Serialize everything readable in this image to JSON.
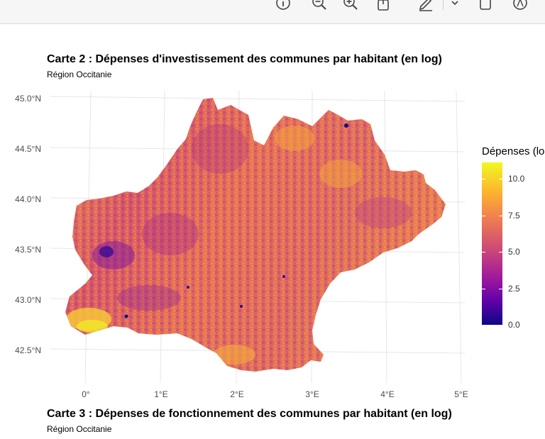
{
  "toolbar": {
    "icons": [
      "info-icon",
      "zoom-out-icon",
      "zoom-in-icon",
      "share-icon",
      "markup-icon",
      "chevron-down-icon",
      "window-icon",
      "search-icon"
    ]
  },
  "map1": {
    "title": "Carte 2 : Dépenses d'investissement des communes par habitant (en log)",
    "subtitle": "Région Occitanie",
    "lat_labels": [
      "45.0°N",
      "44.5°N",
      "44.0°N",
      "43.5°N",
      "43.0°N",
      "42.5°N"
    ],
    "lon_labels": [
      "0°",
      "1°E",
      "2°E",
      "3°E",
      "4°E",
      "5°E"
    ],
    "legend": {
      "title": "Dépenses (lo",
      "tick_labels": [
        "10.0",
        "7.5",
        "5.0",
        "2.5",
        "0.0"
      ],
      "ticks": [
        10.0,
        7.5,
        5.0,
        2.5,
        0.0
      ],
      "range": [
        0.0,
        11.0
      ],
      "colormap": "plasma",
      "colors": [
        "#0d0887",
        "#5c01a6",
        "#9c179e",
        "#cc4778",
        "#ed7953",
        "#fdb42f",
        "#f0f921"
      ]
    }
  },
  "map2": {
    "title": "Carte 3 : Dépenses de fonctionnement des communes par habitant (en log)",
    "subtitle": "Région Occitanie"
  }
}
